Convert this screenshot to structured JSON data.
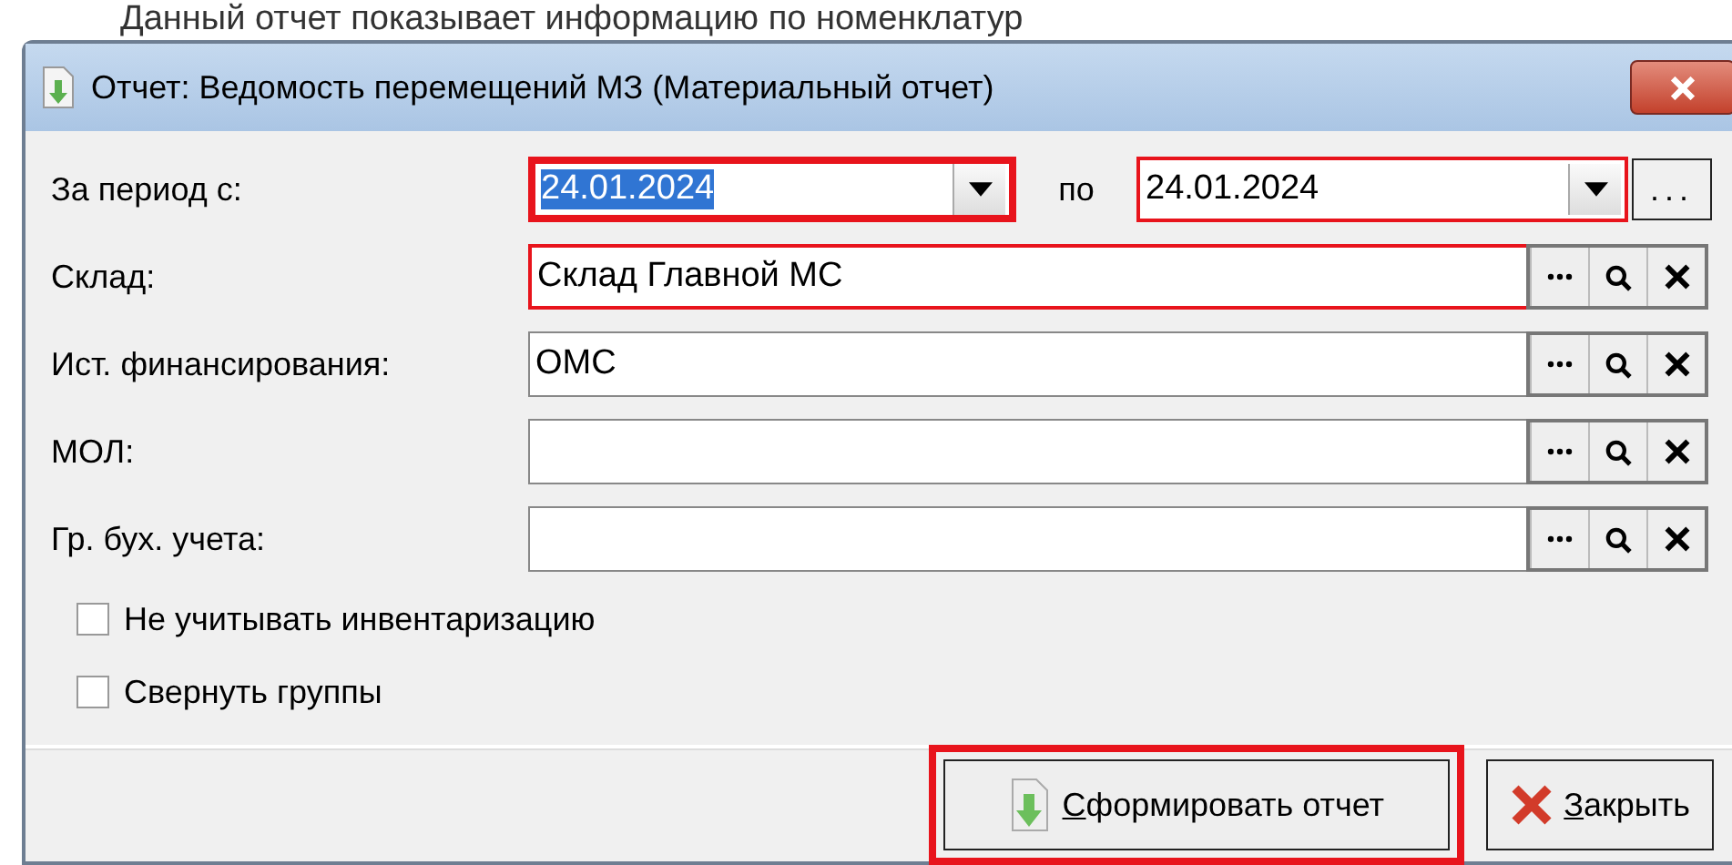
{
  "background_text": "Данный отчет показывает информацию по номенклатур",
  "window": {
    "title": "Отчет: Ведомость перемещений МЗ (Материальный отчет)"
  },
  "period": {
    "label": "За период с:",
    "from": {
      "value": "24.01.2024",
      "text_selected": true,
      "highlighted": true
    },
    "separator": "по",
    "to": {
      "value": "24.01.2024",
      "text_selected": false,
      "highlighted": false,
      "required": true
    },
    "more": "..."
  },
  "fields": [
    {
      "label": "Склад:",
      "value": "Склад Главной МС",
      "required": true
    },
    {
      "label": "Ист. финансирования:",
      "value": "ОМС",
      "required": false
    },
    {
      "label": "МОЛ:",
      "required": false
    },
    {
      "label": "Гр. бух. учета:",
      "required": false
    }
  ],
  "checkboxes": [
    {
      "label": "Не учитывать инвентаризацию",
      "checked": false
    },
    {
      "label": "Свернуть группы",
      "checked": false
    }
  ],
  "buttons": [
    {
      "kind": "generate",
      "label": "Сформировать отчет",
      "highlighted": true
    },
    {
      "kind": "close",
      "label": "Закрыть",
      "highlighted": false
    }
  ]
}
